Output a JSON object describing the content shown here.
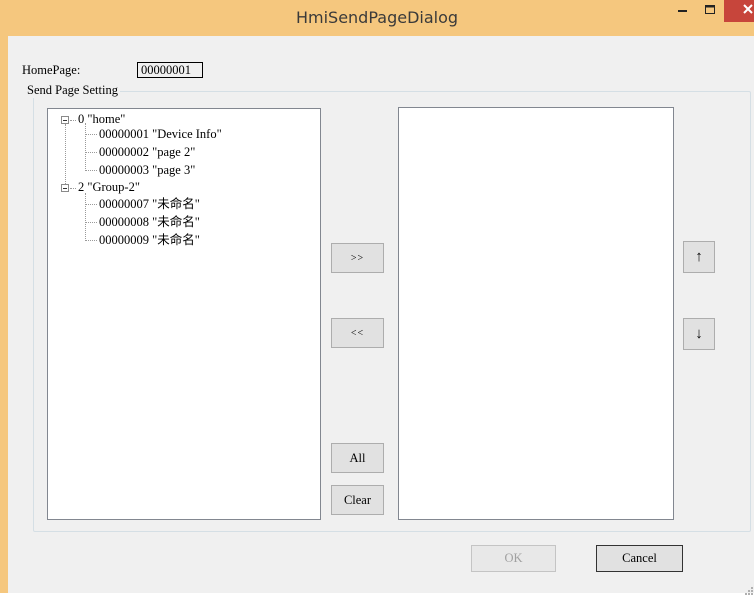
{
  "window": {
    "title": "HmiSendPageDialog",
    "minimize_icon": "minimize-icon",
    "maximize_icon": "maximize-icon",
    "close_icon": "close-icon"
  },
  "home_page": {
    "label": "HomePage:",
    "value": "00000001"
  },
  "group": {
    "legend": "Send Page Setting"
  },
  "tree": {
    "groups": [
      {
        "label": "0 \"home\"",
        "pages": [
          "00000001 \"Device Info\"",
          "00000002 \"page 2\"",
          "00000003 \"page 3\""
        ]
      },
      {
        "label": "2 \"Group-2\"",
        "pages": [
          "00000007 \"未命名\"",
          "00000008 \"未命名\"",
          "00000009 \"未命名\""
        ]
      }
    ]
  },
  "buttons": {
    "add": ">>",
    "remove": "<<",
    "all": "All",
    "clear": "Clear",
    "up": "↑",
    "down": "↓",
    "ok": "OK",
    "cancel": "Cancel"
  },
  "colors": {
    "titlebar": "#f5c77e",
    "close_button": "#c7453b",
    "client_background": "#f0f0f0"
  }
}
